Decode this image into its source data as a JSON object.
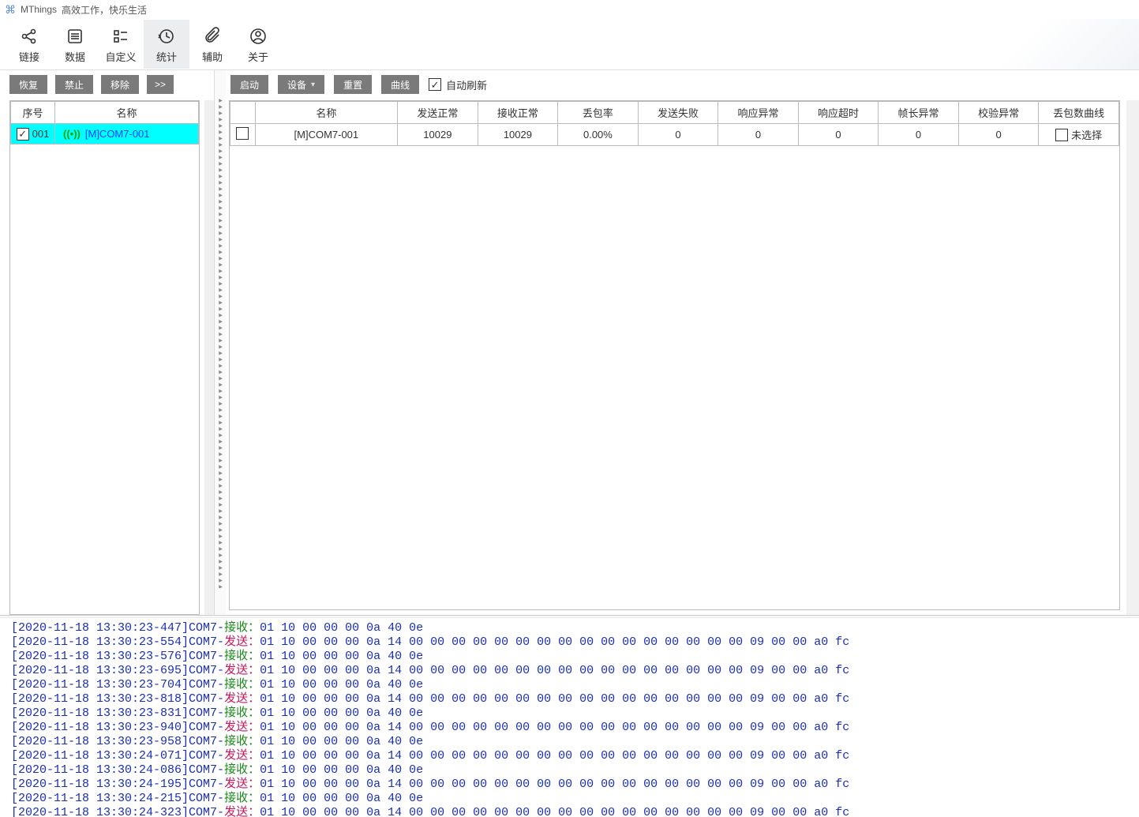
{
  "titlebar": {
    "app": "MThings",
    "slogan": "高效工作，快乐生活"
  },
  "toolbar": {
    "items": [
      {
        "id": "link",
        "label": "链接",
        "icon": "share"
      },
      {
        "id": "data",
        "label": "数据",
        "icon": "list"
      },
      {
        "id": "custom",
        "label": "自定义",
        "icon": "checklist"
      },
      {
        "id": "stats",
        "label": "统计",
        "icon": "history",
        "active": true
      },
      {
        "id": "assist",
        "label": "辅助",
        "icon": "clip"
      },
      {
        "id": "about",
        "label": "关于",
        "icon": "user"
      }
    ]
  },
  "left": {
    "buttons": {
      "restore": "恢复",
      "forbid": "禁止",
      "remove": "移除",
      "expand": ">>"
    },
    "headers": {
      "seq": "序号",
      "name": "名称"
    },
    "rows": [
      {
        "checked": true,
        "seq": "001",
        "name": "[M]COM7-001"
      }
    ]
  },
  "right": {
    "buttons": {
      "start": "启动",
      "device": "设备",
      "reset": "重置",
      "curve": "曲线"
    },
    "autoRefresh": {
      "label": "自动刷新",
      "checked": true
    },
    "headers": {
      "chk": "",
      "name": "名称",
      "sendOk": "发送正常",
      "recvOk": "接收正常",
      "lossRate": "丢包率",
      "sendFail": "发送失败",
      "respErr": "响应异常",
      "respTimeout": "响应超时",
      "frameLenErr": "帧长异常",
      "crcErr": "校验异常",
      "lossCurve": "丢包数曲线"
    },
    "rows": [
      {
        "checked": false,
        "name": "[M]COM7-001",
        "sendOk": "10029",
        "recvOk": "10029",
        "lossRate": "0.00%",
        "sendFail": "0",
        "respErr": "0",
        "respTimeout": "0",
        "frameLenErr": "0",
        "crcErr": "0",
        "lossCurve": "未选择",
        "curveChecked": false
      }
    ]
  },
  "log": {
    "lines": [
      {
        "ts": "[2020-11-18 13:30:23-447]",
        "port": "COM7-",
        "act": "接收：",
        "type": "r",
        "data": "01 10 00 00 00 0a 40 0e"
      },
      {
        "ts": "[2020-11-18 13:30:23-554]",
        "port": "COM7-",
        "act": "发送：",
        "type": "s",
        "data": "01 10 00 00 00 0a 14 00 00 00 00 00 00 00 00 00 00 00 00 00 00 00 00 09 00 00 a0 fc"
      },
      {
        "ts": "[2020-11-18 13:30:23-576]",
        "port": "COM7-",
        "act": "接收：",
        "type": "r",
        "data": "01 10 00 00 00 0a 40 0e"
      },
      {
        "ts": "[2020-11-18 13:30:23-695]",
        "port": "COM7-",
        "act": "发送：",
        "type": "s",
        "data": "01 10 00 00 00 0a 14 00 00 00 00 00 00 00 00 00 00 00 00 00 00 00 00 09 00 00 a0 fc"
      },
      {
        "ts": "[2020-11-18 13:30:23-704]",
        "port": "COM7-",
        "act": "接收：",
        "type": "r",
        "data": "01 10 00 00 00 0a 40 0e"
      },
      {
        "ts": "[2020-11-18 13:30:23-818]",
        "port": "COM7-",
        "act": "发送：",
        "type": "s",
        "data": "01 10 00 00 00 0a 14 00 00 00 00 00 00 00 00 00 00 00 00 00 00 00 00 09 00 00 a0 fc"
      },
      {
        "ts": "[2020-11-18 13:30:23-831]",
        "port": "COM7-",
        "act": "接收：",
        "type": "r",
        "data": "01 10 00 00 00 0a 40 0e"
      },
      {
        "ts": "[2020-11-18 13:30:23-940]",
        "port": "COM7-",
        "act": "发送：",
        "type": "s",
        "data": "01 10 00 00 00 0a 14 00 00 00 00 00 00 00 00 00 00 00 00 00 00 00 00 09 00 00 a0 fc"
      },
      {
        "ts": "[2020-11-18 13:30:23-958]",
        "port": "COM7-",
        "act": "接收：",
        "type": "r",
        "data": "01 10 00 00 00 0a 40 0e"
      },
      {
        "ts": "[2020-11-18 13:30:24-071]",
        "port": "COM7-",
        "act": "发送：",
        "type": "s",
        "data": "01 10 00 00 00 0a 14 00 00 00 00 00 00 00 00 00 00 00 00 00 00 00 00 09 00 00 a0 fc"
      },
      {
        "ts": "[2020-11-18 13:30:24-086]",
        "port": "COM7-",
        "act": "接收：",
        "type": "r",
        "data": "01 10 00 00 00 0a 40 0e"
      },
      {
        "ts": "[2020-11-18 13:30:24-195]",
        "port": "COM7-",
        "act": "发送：",
        "type": "s",
        "data": "01 10 00 00 00 0a 14 00 00 00 00 00 00 00 00 00 00 00 00 00 00 00 00 09 00 00 a0 fc"
      },
      {
        "ts": "[2020-11-18 13:30:24-215]",
        "port": "COM7-",
        "act": "接收：",
        "type": "r",
        "data": "01 10 00 00 00 0a 40 0e"
      },
      {
        "ts": "[2020-11-18 13:30:24-323]",
        "port": "COM7-",
        "act": "发送：",
        "type": "s",
        "data": "01 10 00 00 00 0a 14 00 00 00 00 00 00 00 00 00 00 00 00 00 00 00 00 09 00 00 a0 fc"
      }
    ]
  }
}
